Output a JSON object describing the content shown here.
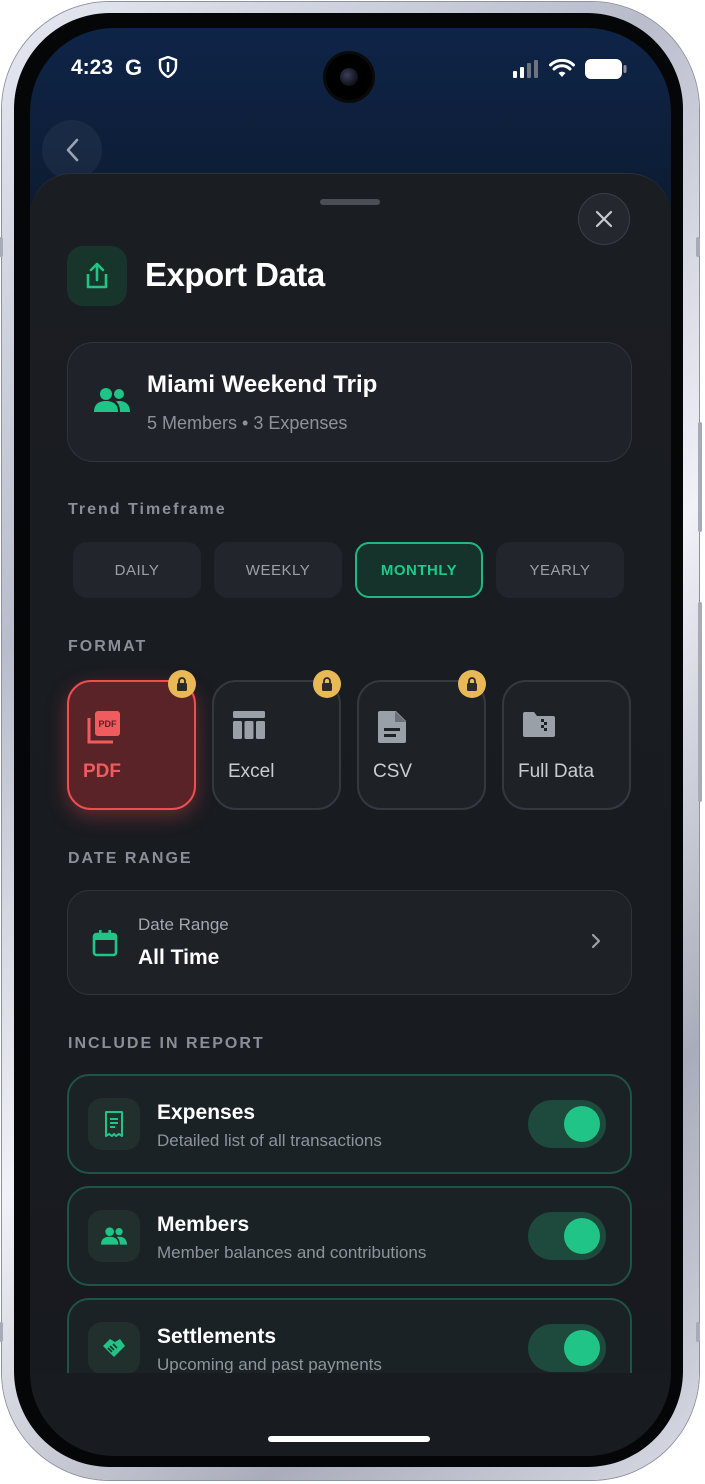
{
  "status_bar": {
    "time": "4:23",
    "g_label": "G"
  },
  "sheet": {
    "title": "Export Data",
    "group": {
      "name": "Miami Weekend Trip",
      "meta": "5 Members • 3 Expenses"
    },
    "timeframe": {
      "label": "Trend Timeframe",
      "options": [
        "DAILY",
        "WEEKLY",
        "MONTHLY",
        "YEARLY"
      ],
      "selected": "MONTHLY"
    },
    "format": {
      "label": "FORMAT",
      "options": [
        {
          "label": "PDF",
          "icon": "pdf-icon",
          "locked": true,
          "selected": true
        },
        {
          "label": "Excel",
          "icon": "table-icon",
          "locked": true,
          "selected": false
        },
        {
          "label": "CSV",
          "icon": "document-icon",
          "locked": true,
          "selected": false
        },
        {
          "label": "Full Data",
          "icon": "folder-zip-icon",
          "locked": false,
          "selected": false
        }
      ]
    },
    "date_range": {
      "section_label": "DATE RANGE",
      "label": "Date Range",
      "value": "All Time"
    },
    "include": {
      "label": "INCLUDE IN REPORT",
      "items": [
        {
          "title": "Expenses",
          "description": "Detailed list of all transactions",
          "icon": "receipt-icon",
          "enabled": true
        },
        {
          "title": "Members",
          "description": "Member balances and contributions",
          "icon": "people-icon",
          "enabled": true
        },
        {
          "title": "Settlements",
          "description": "Upcoming and past payments",
          "icon": "handshake-icon",
          "enabled": true
        }
      ]
    }
  },
  "colors": {
    "accent_green": "#1fc486",
    "pdf_red": "#ef4d4f",
    "lock_gold": "#e8b956",
    "sheet_bg": "#1a1d22"
  }
}
